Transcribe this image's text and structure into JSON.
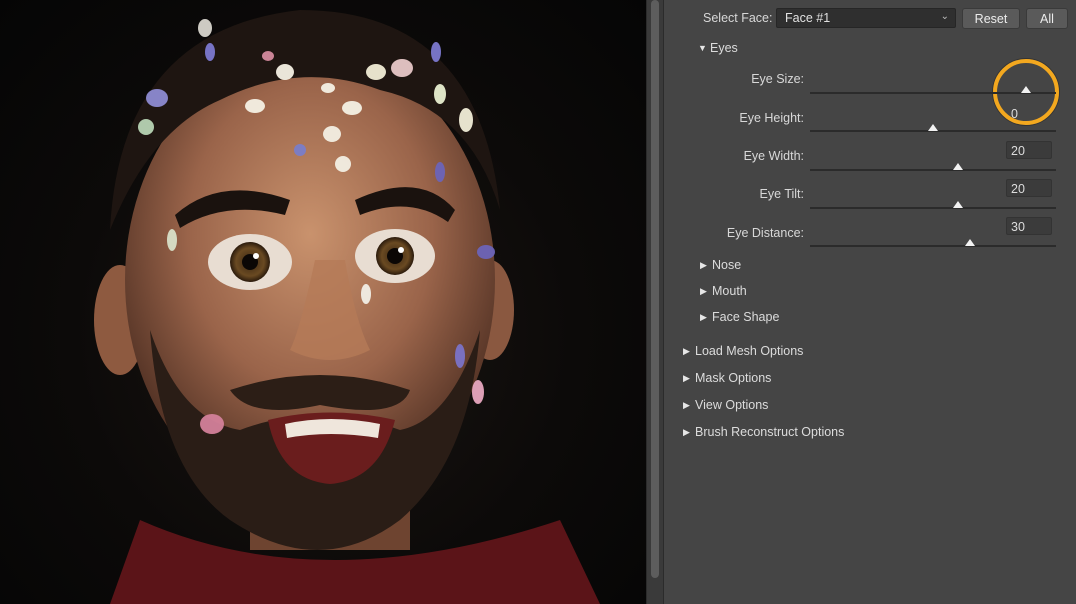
{
  "panel": {
    "select_face_label": "Select Face:",
    "select_face_value": "Face #1",
    "reset_button": "Reset",
    "all_button": "All",
    "eyes": {
      "heading": "Eyes",
      "sliders": [
        {
          "label": "Eye Size:",
          "value": "",
          "level": 0.88
        },
        {
          "label": "Eye Height:",
          "value": "0",
          "level": 0.5
        },
        {
          "label": "Eye Width:",
          "value": "20",
          "level": 0.6
        },
        {
          "label": "Eye Tilt:",
          "value": "20",
          "level": 0.6
        },
        {
          "label": "Eye Distance:",
          "value": "30",
          "level": 0.65
        }
      ]
    },
    "face_subsections": [
      "Nose",
      "Mouth",
      "Face Shape"
    ],
    "option_sections": [
      "Load Mesh Options",
      "Mask Options",
      "View Options",
      "Brush Reconstruct Options"
    ]
  },
  "colors": {
    "panel_bg": "#454545",
    "highlight": "#f3a81f"
  }
}
